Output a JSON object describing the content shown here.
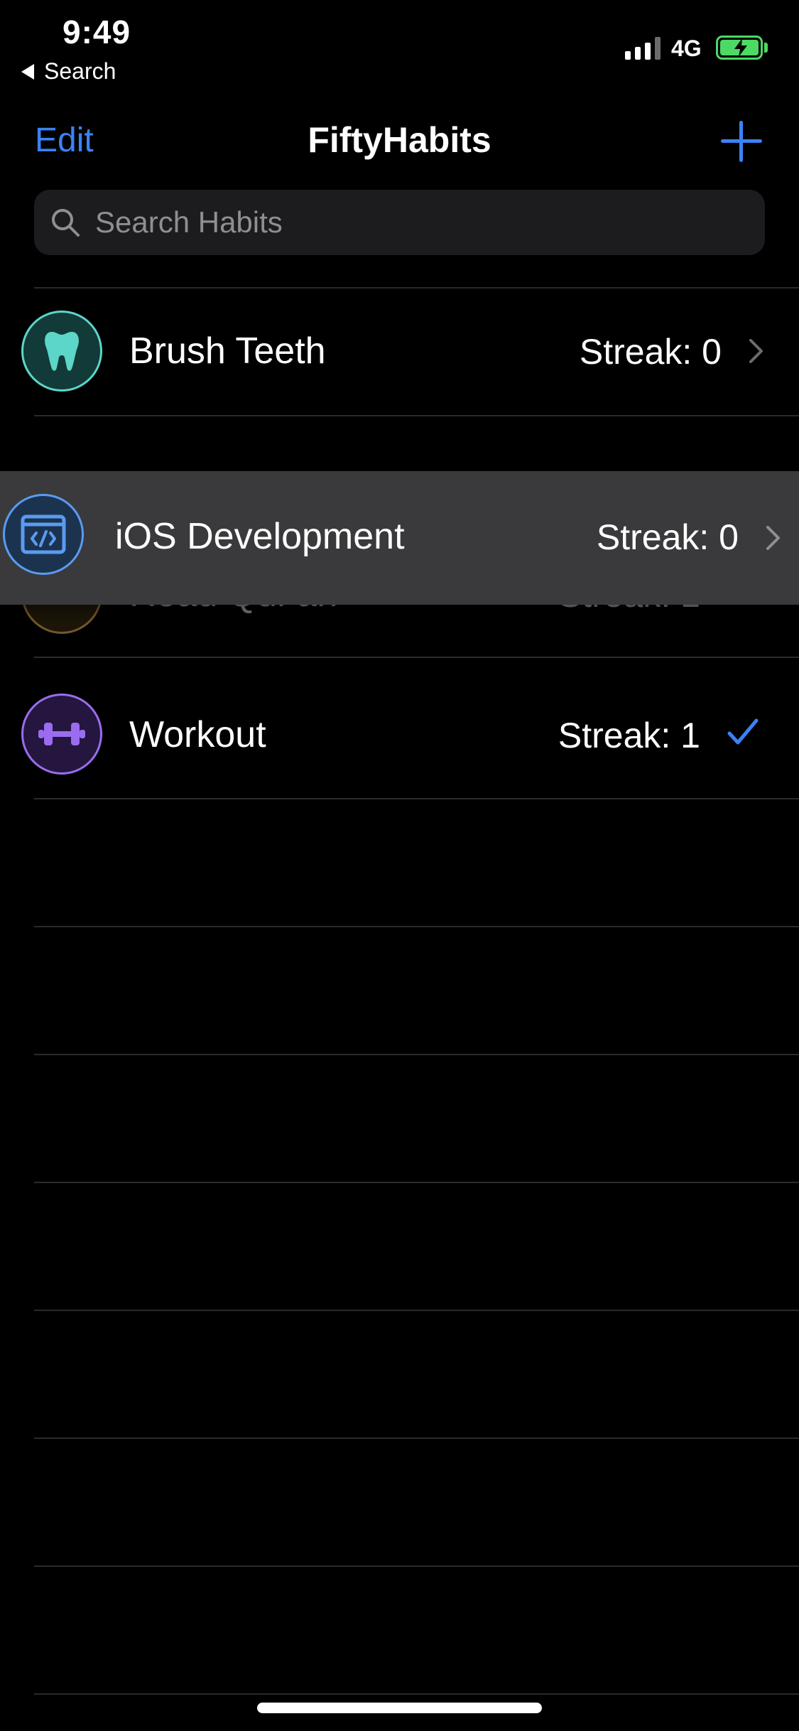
{
  "status_bar": {
    "time": "9:49",
    "back_label": "Search",
    "network": "4G",
    "battery": "charging"
  },
  "nav": {
    "edit_label": "Edit",
    "title": "FiftyHabits",
    "add_icon": "plus-icon"
  },
  "search": {
    "placeholder": "Search Habits"
  },
  "habits": [
    {
      "name": "Brush Teeth",
      "streak": "Streak: 0",
      "accessory": "chevron",
      "icon": "tooth-icon",
      "color": "#5bd6c8"
    },
    {
      "name": "Read Qur'an",
      "streak": "Streak: 1",
      "accessory": "checkmark",
      "icon": "book-icon",
      "color": "#e8b25a"
    },
    {
      "name": "Workout",
      "streak": "Streak: 1",
      "accessory": "checkmark",
      "icon": "dumbbell-icon",
      "color": "#9b6cf0"
    }
  ],
  "dragging": {
    "name": "iOS Development",
    "streak": "Streak: 0",
    "accessory": "chevron",
    "icon": "code-window-icon",
    "color": "#5a9bf0"
  },
  "colors": {
    "accent": "#3b82f6",
    "background": "#000000",
    "dragged_row": "#3a3a3c"
  }
}
